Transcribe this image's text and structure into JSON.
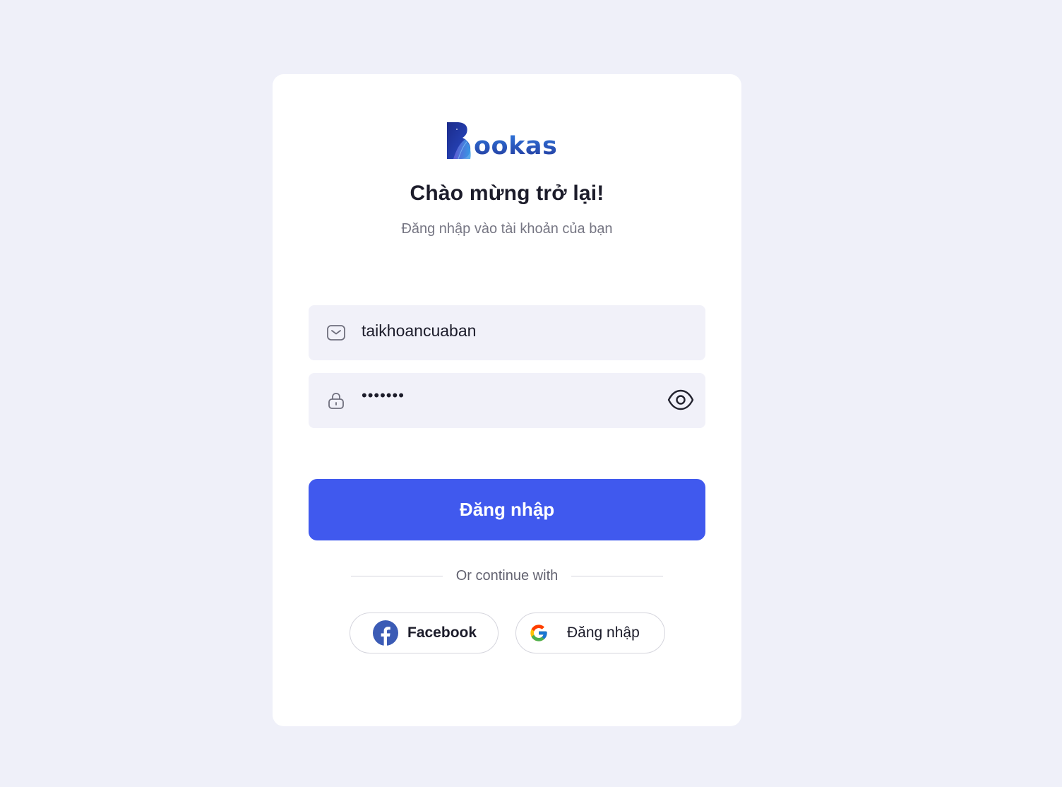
{
  "brand": {
    "name": "Bookas",
    "logo_text": "ookas",
    "colors": {
      "primary": "#4059ee",
      "logo_dark": "#1f2f8f",
      "logo_light": "#2f73d8"
    }
  },
  "header": {
    "title": "Chào mừng trở lại!",
    "subtitle": "Đăng nhập vào tài khoản của bạn"
  },
  "form": {
    "email": {
      "value": "taikhoancuaban",
      "icon": "mail-icon"
    },
    "password": {
      "value": "1234567",
      "icon": "lock-icon",
      "toggle_icon": "eye-icon"
    },
    "submit_label": "Đăng nhập"
  },
  "divider": {
    "text": "Or continue with"
  },
  "social": {
    "facebook": {
      "label": "Facebook",
      "icon": "facebook-icon"
    },
    "google": {
      "label": "Đăng nhập",
      "icon": "google-icon"
    }
  }
}
